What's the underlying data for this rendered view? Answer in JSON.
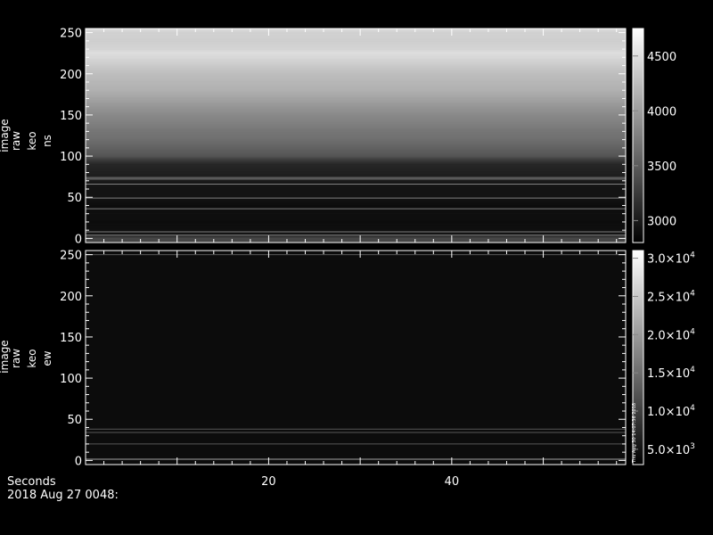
{
  "chart_data": [
    {
      "type": "heatmap",
      "panel": "top",
      "ylabel_lines": [
        "image",
        "raw",
        "keo",
        "ns"
      ],
      "ylim": [
        -5,
        255
      ],
      "y_ticks": [
        0,
        50,
        100,
        150,
        200,
        250
      ],
      "y_tick_labels": [
        "0",
        "50",
        "100",
        "150",
        "200",
        "250"
      ],
      "x_ticks": [
        10,
        20,
        30,
        40,
        50
      ],
      "colorbar": {
        "range": [
          2800,
          4750
        ],
        "ticks": [
          3000,
          3500,
          4000,
          4500
        ],
        "tick_labels": [
          "3000",
          "3500",
          "4000",
          "4500"
        ]
      },
      "row_profile": [
        [
          -5,
          3300
        ],
        [
          0,
          3350
        ],
        [
          5,
          2950
        ],
        [
          10,
          2920
        ],
        [
          20,
          2900
        ],
        [
          30,
          2920
        ],
        [
          40,
          2900
        ],
        [
          50,
          2950
        ],
        [
          60,
          2950
        ],
        [
          70,
          3000
        ],
        [
          80,
          3050
        ],
        [
          90,
          3100
        ],
        [
          95,
          3250
        ],
        [
          100,
          3450
        ],
        [
          110,
          3550
        ],
        [
          120,
          3650
        ],
        [
          130,
          3700
        ],
        [
          140,
          3780
        ],
        [
          150,
          3850
        ],
        [
          160,
          3950
        ],
        [
          170,
          4050
        ],
        [
          180,
          4150
        ],
        [
          190,
          4200
        ],
        [
          200,
          4250
        ],
        [
          210,
          4350
        ],
        [
          220,
          4450
        ],
        [
          225,
          4500
        ],
        [
          230,
          4420
        ],
        [
          240,
          4380
        ],
        [
          250,
          4400
        ],
        [
          255,
          4500
        ]
      ],
      "bright_rows": [
        4,
        8,
        36,
        49,
        66,
        72,
        74
      ]
    },
    {
      "type": "heatmap",
      "panel": "bottom",
      "ylabel_lines": [
        "image",
        "raw",
        "keo",
        "ew"
      ],
      "ylim": [
        -5,
        255
      ],
      "y_ticks": [
        0,
        50,
        100,
        150,
        200,
        250
      ],
      "y_tick_labels": [
        "0",
        "50",
        "100",
        "150",
        "200",
        "250"
      ],
      "x_ticks": [
        10,
        20,
        30,
        40,
        50
      ],
      "x_tick_labels": [
        "",
        "20",
        "",
        "40",
        ""
      ],
      "xlim": [
        0,
        59
      ],
      "colorbar": {
        "range": [
          3000,
          31000
        ],
        "ticks": [
          5000,
          10000,
          15000,
          20000,
          25000,
          30000
        ],
        "tick_mantissas": [
          "5.0",
          "1.0",
          "1.5",
          "2.0",
          "2.5",
          "3.0"
        ],
        "tick_exponents": [
          "3",
          "4",
          "4",
          "4",
          "4",
          "4"
        ],
        "side_note": "Thu Aug 30 14:07:36 2018"
      },
      "bright_rows": [
        1,
        2,
        20,
        34,
        38,
        250
      ]
    }
  ],
  "footer": {
    "x_axis_title": "Seconds",
    "timestamp": "2018 Aug 27 0048:"
  }
}
